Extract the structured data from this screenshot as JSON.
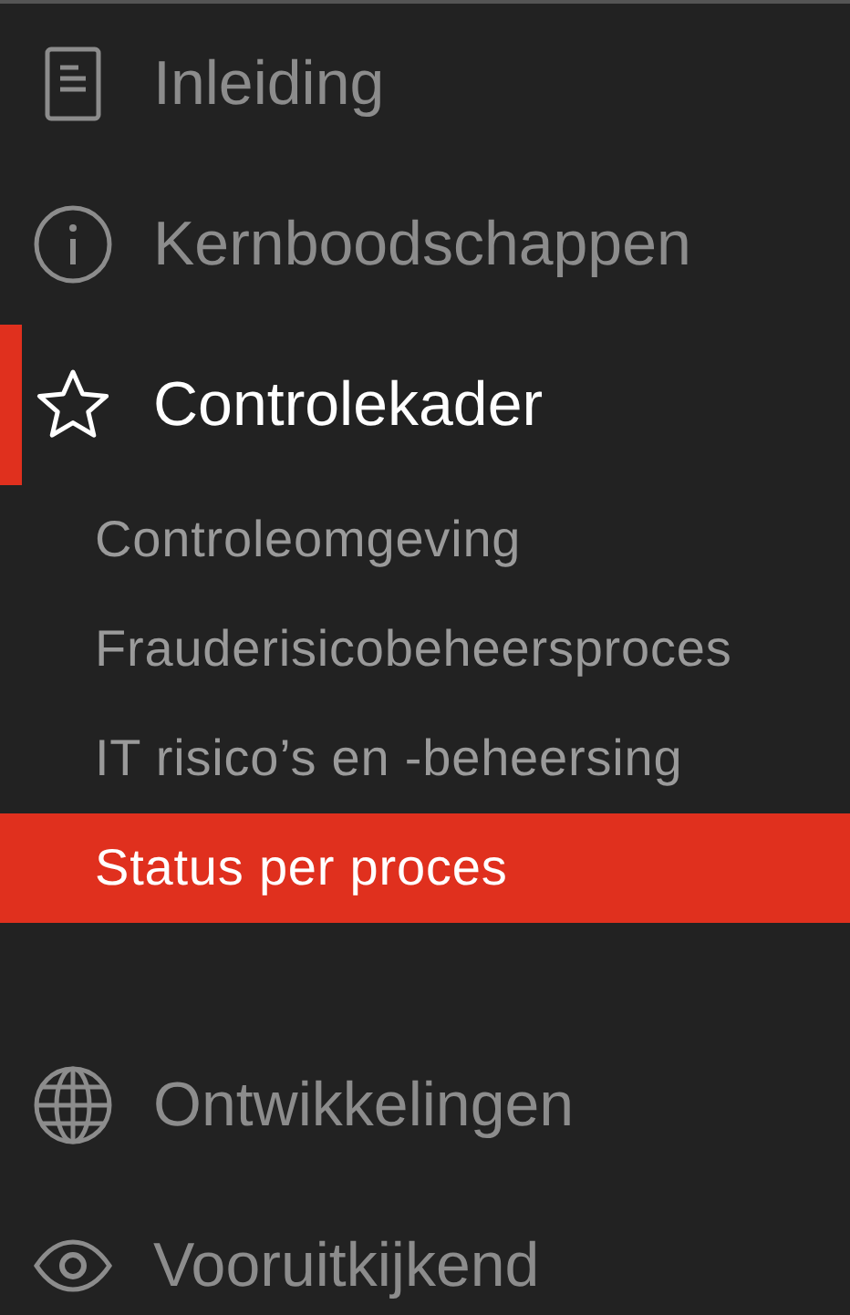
{
  "sections": [
    {
      "label": "Inleiding",
      "selected": false
    },
    {
      "label": "Kernboodschappen",
      "selected": false
    },
    {
      "label": "Controlekader",
      "selected": true,
      "children": [
        {
          "label": "Controleomgeving",
          "selected": false
        },
        {
          "label": "Frauderisicobeheersproces",
          "selected": false
        },
        {
          "label": "IT risico’s en -beheersing",
          "selected": false
        },
        {
          "label": "Status per proces",
          "selected": true
        }
      ]
    },
    {
      "label": "Ontwikkelingen",
      "selected": false
    },
    {
      "label": "Vooruitkijkend",
      "selected": false
    }
  ]
}
